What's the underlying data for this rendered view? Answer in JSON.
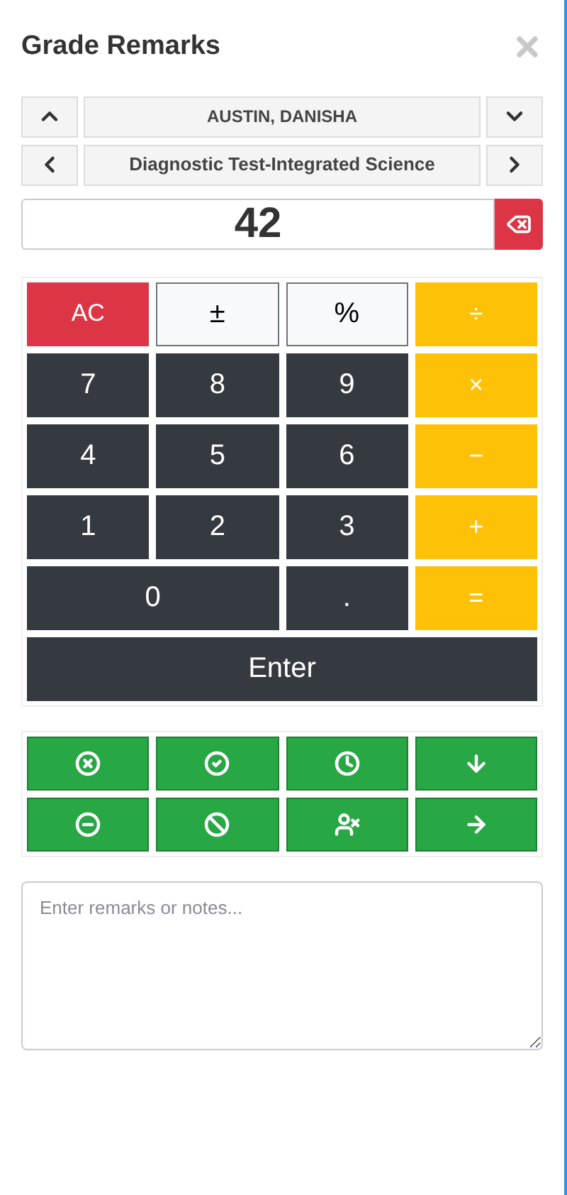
{
  "title": "Grade Remarks",
  "student": {
    "name": "AUSTIN, DANISHA"
  },
  "assessment": {
    "name": "Diagnostic Test-Integrated Science"
  },
  "score": {
    "value": "42"
  },
  "keypad": {
    "keys": [
      {
        "label": "AC",
        "kind": "clear"
      },
      {
        "label": "±",
        "kind": "function"
      },
      {
        "label": "%",
        "kind": "function"
      },
      {
        "label": "÷",
        "kind": "operator"
      },
      {
        "label": "7",
        "kind": "digit"
      },
      {
        "label": "8",
        "kind": "digit"
      },
      {
        "label": "9",
        "kind": "digit"
      },
      {
        "label": "×",
        "kind": "operator"
      },
      {
        "label": "4",
        "kind": "digit"
      },
      {
        "label": "5",
        "kind": "digit"
      },
      {
        "label": "6",
        "kind": "digit"
      },
      {
        "label": "−",
        "kind": "operator"
      },
      {
        "label": "1",
        "kind": "digit"
      },
      {
        "label": "2",
        "kind": "digit"
      },
      {
        "label": "3",
        "kind": "digit"
      },
      {
        "label": "+",
        "kind": "operator"
      },
      {
        "label": "0",
        "kind": "wide"
      },
      {
        "label": ".",
        "kind": "digit"
      },
      {
        "label": "=",
        "kind": "operator"
      },
      {
        "label": "Enter",
        "kind": "enter"
      }
    ]
  },
  "remarks": {
    "placeholder": "Enter remarks or notes..."
  }
}
